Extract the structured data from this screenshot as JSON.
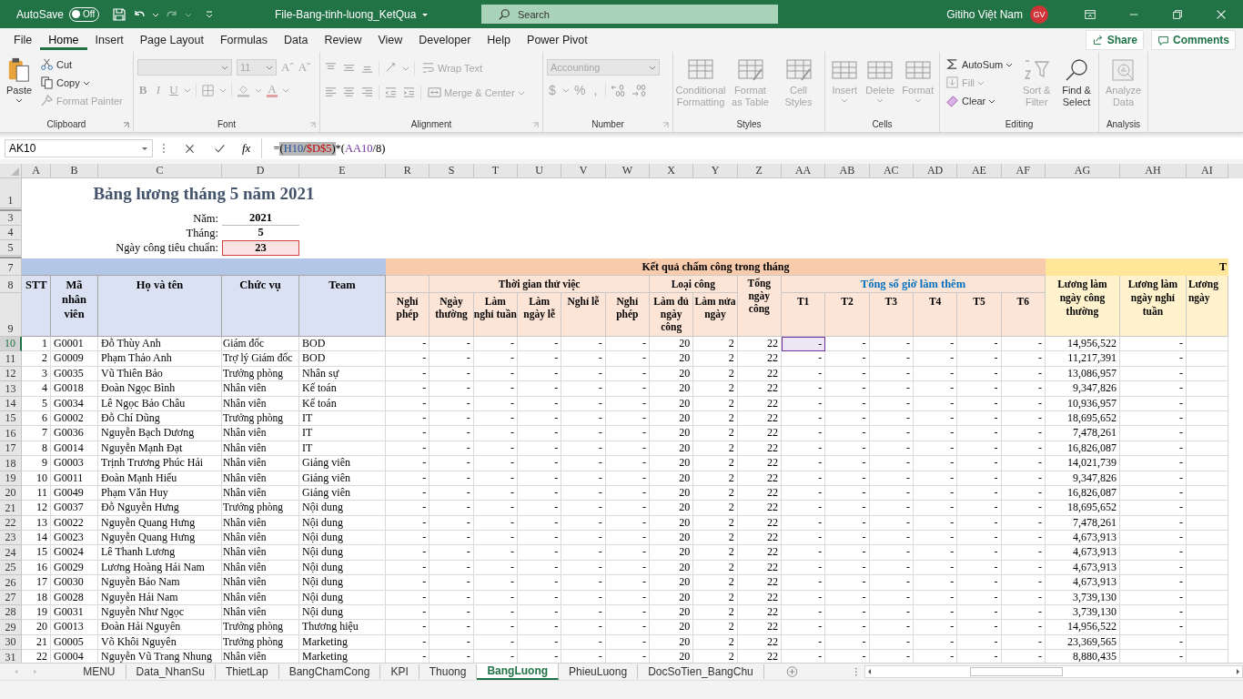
{
  "title_bar": {
    "autosave_label": "AutoSave",
    "autosave": {
      "label": "Off",
      "on": false
    },
    "redo_disabled": true,
    "file_name": "File-Bang-tinh-luong_KetQua",
    "search_placeholder": "Search",
    "user_name": "Gitiho Việt Nam",
    "avatar_initials": "GV"
  },
  "menu_tabs": [
    {
      "label": "File",
      "selected": false
    },
    {
      "label": "Home",
      "selected": true
    },
    {
      "label": "Insert",
      "selected": false
    },
    {
      "label": "Page Layout",
      "selected": false
    },
    {
      "label": "Formulas",
      "selected": false
    },
    {
      "label": "Data",
      "selected": false
    },
    {
      "label": "Review",
      "selected": false
    },
    {
      "label": "View",
      "selected": false
    },
    {
      "label": "Developer",
      "selected": false
    },
    {
      "label": "Help",
      "selected": false
    },
    {
      "label": "Power Pivot",
      "selected": false
    }
  ],
  "share": "Share",
  "comments": "Comments",
  "ribbon": {
    "clipboard": {
      "label": "Clipboard",
      "paste": {
        "label": "Paste",
        "disabled": false
      },
      "cut": {
        "label": "Cut",
        "disabled": false
      },
      "copy": {
        "label": "Copy",
        "disabled": false
      },
      "format_painter": {
        "label": "Format Painter",
        "disabled": true
      }
    },
    "font": {
      "label": "Font",
      "disabled": true,
      "size": "11",
      "grow": "Aˆ",
      "shrink": "Aˇ",
      "bold": "B",
      "italic": "I",
      "underline": "U",
      "font_color": "A"
    },
    "alignment": {
      "label": "Alignment",
      "disabled": true,
      "wrap_text": "Wrap Text",
      "merge_center": "Merge & Center"
    },
    "number": {
      "label": "Number",
      "disabled": true,
      "format": "Accounting",
      "currency": "$",
      "percent": "%",
      "comma": ","
    },
    "styles": {
      "label": "Styles",
      "disabled": true,
      "items": [
        "Conditional Formatting",
        "Format as Table",
        "Cell Styles"
      ]
    },
    "cells": {
      "label": "Cells",
      "disabled": true,
      "items": [
        "Insert",
        "Delete",
        "Format"
      ]
    },
    "editing": {
      "label": "Editing",
      "autosum": {
        "label": "AutoSum",
        "disabled": false
      },
      "fill": {
        "label": "Fill",
        "disabled": true
      },
      "clear": {
        "label": "Clear",
        "disabled": false
      },
      "sort_filter": {
        "label": "Sort & Filter",
        "disabled": true
      },
      "find_select": {
        "label": "Find & Select",
        "disabled": false
      }
    },
    "analysis": {
      "label": "Analysis",
      "analyze_data": {
        "label": "Analyze Data",
        "disabled": true
      }
    }
  },
  "formula_bar": {
    "name_box": "AK10",
    "fx": "fx",
    "tokens": [
      {
        "text": "=",
        "selected": false
      },
      {
        "text": "(",
        "selected": true
      },
      {
        "text": "H10",
        "color": "#1f4e9c",
        "selected": true
      },
      {
        "text": "/",
        "selected": true
      },
      {
        "text": "$D$5",
        "color": "#c00000",
        "selected": true
      },
      {
        "text": ")",
        "selected": true
      },
      {
        "text": "*(",
        "selected": false
      },
      {
        "text": "AA10",
        "color": "#7030a0",
        "selected": false
      },
      {
        "text": "/8)",
        "selected": false
      }
    ]
  },
  "sheet": {
    "column_headers": [
      "A",
      "B",
      "C",
      "D",
      "E",
      "R",
      "S",
      "T",
      "U",
      "V",
      "W",
      "X",
      "Y",
      "Z",
      "AA",
      "AB",
      "AC",
      "AD",
      "AE",
      "AF",
      "AG",
      "AH",
      "AI"
    ],
    "top_row_headers": [
      "1",
      "3",
      "4",
      "5",
      "7",
      "8",
      "9"
    ],
    "title": "Bảng lương tháng 5 năm 2021",
    "params": [
      {
        "label": "Năm:",
        "value": "2021",
        "referenced": false
      },
      {
        "label": "Tháng:",
        "value": "5",
        "referenced": false
      },
      {
        "label": "Ngày công tiêu chuẩn:",
        "value": "23",
        "referenced": true
      }
    ],
    "attendance_band": "Kết quả chấm công trong tháng",
    "salary_band": "T",
    "employee_headers": [
      "STT",
      "Mã nhân viên",
      "Họ và tên",
      "Chức vụ",
      "Team"
    ],
    "leave_header": "Nghỉ phép",
    "probation": {
      "label": "Thời gian thử việc",
      "columns": [
        "Ngày thường",
        "Làm nghỉ tuần",
        "Làm ngày lễ",
        "Nghỉ lễ",
        "Nghỉ phép"
      ]
    },
    "work_type": {
      "label": "Loại công",
      "columns": [
        "Làm đủ ngày công",
        "Làm nửa ngày"
      ]
    },
    "total_days": "Tổng ngày công",
    "overtime": {
      "label": "Tổng số giờ làm thêm",
      "columns": [
        "T1",
        "T2",
        "T3",
        "T4",
        "T5",
        "T6"
      ]
    },
    "salary_headers": [
      "Lương làm ngày công thường",
      "Lương làm ngày nghỉ tuần",
      "Lương ngày"
    ],
    "rows": [
      {
        "row": "10",
        "active": true,
        "stt": "1",
        "code": "G0001",
        "name": "Đỗ Thùy Anh",
        "position": "Giám đốc",
        "team": "BOD",
        "days": [
          "-",
          "-",
          "-",
          "-",
          "-",
          "-"
        ],
        "full": "20",
        "half": "2",
        "total": "22",
        "overtime": [
          "-",
          "-",
          "-",
          "-",
          "-",
          "-"
        ],
        "referenced": true,
        "salary": [
          "14,956,522",
          "-"
        ]
      },
      {
        "row": "11",
        "active": false,
        "stt": "2",
        "code": "G0009",
        "name": "Phạm Thảo Anh",
        "position": "Trợ lý Giám đốc",
        "team": "BOD",
        "days": [
          "-",
          "-",
          "-",
          "-",
          "-",
          "-"
        ],
        "full": "20",
        "half": "2",
        "total": "22",
        "overtime": [
          "-",
          "-",
          "-",
          "-",
          "-",
          "-"
        ],
        "referenced": false,
        "salary": [
          "11,217,391",
          "-"
        ]
      },
      {
        "row": "12",
        "active": false,
        "stt": "3",
        "code": "G0035",
        "name": "Vũ Thiên Bảo",
        "position": "Trưởng phòng",
        "team": "Nhân sự",
        "days": [
          "-",
          "-",
          "-",
          "-",
          "-",
          "-"
        ],
        "full": "20",
        "half": "2",
        "total": "22",
        "overtime": [
          "-",
          "-",
          "-",
          "-",
          "-",
          "-"
        ],
        "referenced": false,
        "salary": [
          "13,086,957",
          "-"
        ]
      },
      {
        "row": "13",
        "active": false,
        "stt": "4",
        "code": "G0018",
        "name": "Đoàn Ngọc Bình",
        "position": "Nhân viên",
        "team": "Kế toán",
        "days": [
          "-",
          "-",
          "-",
          "-",
          "-",
          "-"
        ],
        "full": "20",
        "half": "2",
        "total": "22",
        "overtime": [
          "-",
          "-",
          "-",
          "-",
          "-",
          "-"
        ],
        "referenced": false,
        "salary": [
          "9,347,826",
          "-"
        ]
      },
      {
        "row": "14",
        "active": false,
        "stt": "5",
        "code": "G0034",
        "name": "Lê Ngọc Bảo Châu",
        "position": "Nhân viên",
        "team": "Kế toán",
        "days": [
          "-",
          "-",
          "-",
          "-",
          "-",
          "-"
        ],
        "full": "20",
        "half": "2",
        "total": "22",
        "overtime": [
          "-",
          "-",
          "-",
          "-",
          "-",
          "-"
        ],
        "referenced": false,
        "salary": [
          "10,936,957",
          "-"
        ]
      },
      {
        "row": "15",
        "active": false,
        "stt": "6",
        "code": "G0002",
        "name": "Đỗ Chí Dũng",
        "position": "Trưởng phòng",
        "team": "IT",
        "days": [
          "-",
          "-",
          "-",
          "-",
          "-",
          "-"
        ],
        "full": "20",
        "half": "2",
        "total": "22",
        "overtime": [
          "-",
          "-",
          "-",
          "-",
          "-",
          "-"
        ],
        "referenced": false,
        "salary": [
          "18,695,652",
          "-"
        ]
      },
      {
        "row": "16",
        "active": false,
        "stt": "7",
        "code": "G0036",
        "name": "Nguyễn Bạch Dương",
        "position": "Nhân viên",
        "team": "IT",
        "days": [
          "-",
          "-",
          "-",
          "-",
          "-",
          "-"
        ],
        "full": "20",
        "half": "2",
        "total": "22",
        "overtime": [
          "-",
          "-",
          "-",
          "-",
          "-",
          "-"
        ],
        "referenced": false,
        "salary": [
          "7,478,261",
          "-"
        ]
      },
      {
        "row": "17",
        "active": false,
        "stt": "8",
        "code": "G0014",
        "name": "Nguyễn Mạnh Đạt",
        "position": "Nhân viên",
        "team": "IT",
        "days": [
          "-",
          "-",
          "-",
          "-",
          "-",
          "-"
        ],
        "full": "20",
        "half": "2",
        "total": "22",
        "overtime": [
          "-",
          "-",
          "-",
          "-",
          "-",
          "-"
        ],
        "referenced": false,
        "salary": [
          "16,826,087",
          "-"
        ]
      },
      {
        "row": "18",
        "active": false,
        "stt": "9",
        "code": "G0003",
        "name": "Trịnh Trương Phúc Hải",
        "position": "Nhân viên",
        "team": "Giảng viên",
        "days": [
          "-",
          "-",
          "-",
          "-",
          "-",
          "-"
        ],
        "full": "20",
        "half": "2",
        "total": "22",
        "overtime": [
          "-",
          "-",
          "-",
          "-",
          "-",
          "-"
        ],
        "referenced": false,
        "salary": [
          "14,021,739",
          "-"
        ]
      },
      {
        "row": "19",
        "active": false,
        "stt": "10",
        "code": "G0011",
        "name": "Đoàn Mạnh Hiếu",
        "position": "Nhân viên",
        "team": "Giảng viên",
        "days": [
          "-",
          "-",
          "-",
          "-",
          "-",
          "-"
        ],
        "full": "20",
        "half": "2",
        "total": "22",
        "overtime": [
          "-",
          "-",
          "-",
          "-",
          "-",
          "-"
        ],
        "referenced": false,
        "salary": [
          "9,347,826",
          "-"
        ]
      },
      {
        "row": "20",
        "active": false,
        "stt": "11",
        "code": "G0049",
        "name": "Phạm Văn Huy",
        "position": "Nhân viên",
        "team": "Giảng viên",
        "days": [
          "-",
          "-",
          "-",
          "-",
          "-",
          "-"
        ],
        "full": "20",
        "half": "2",
        "total": "22",
        "overtime": [
          "-",
          "-",
          "-",
          "-",
          "-",
          "-"
        ],
        "referenced": false,
        "salary": [
          "16,826,087",
          "-"
        ]
      },
      {
        "row": "21",
        "active": false,
        "stt": "12",
        "code": "G0037",
        "name": "Đỗ Nguyễn Hưng",
        "position": "Trưởng phòng",
        "team": "Nội dung",
        "days": [
          "-",
          "-",
          "-",
          "-",
          "-",
          "-"
        ],
        "full": "20",
        "half": "2",
        "total": "22",
        "overtime": [
          "-",
          "-",
          "-",
          "-",
          "-",
          "-"
        ],
        "referenced": false,
        "salary": [
          "18,695,652",
          "-"
        ]
      },
      {
        "row": "22",
        "active": false,
        "stt": "13",
        "code": "G0022",
        "name": "Nguyễn Quang Hưng",
        "position": "Nhân viên",
        "team": "Nội dung",
        "days": [
          "-",
          "-",
          "-",
          "-",
          "-",
          "-"
        ],
        "full": "20",
        "half": "2",
        "total": "22",
        "overtime": [
          "-",
          "-",
          "-",
          "-",
          "-",
          "-"
        ],
        "referenced": false,
        "salary": [
          "7,478,261",
          "-"
        ]
      },
      {
        "row": "23",
        "active": false,
        "stt": "14",
        "code": "G0023",
        "name": "Nguyễn Quang Hưng",
        "position": "Nhân viên",
        "team": "Nội dung",
        "days": [
          "-",
          "-",
          "-",
          "-",
          "-",
          "-"
        ],
        "full": "20",
        "half": "2",
        "total": "22",
        "overtime": [
          "-",
          "-",
          "-",
          "-",
          "-",
          "-"
        ],
        "referenced": false,
        "salary": [
          "4,673,913",
          "-"
        ]
      },
      {
        "row": "24",
        "active": false,
        "stt": "15",
        "code": "G0024",
        "name": "Lê Thanh Lương",
        "position": "Nhân viên",
        "team": "Nội dung",
        "days": [
          "-",
          "-",
          "-",
          "-",
          "-",
          "-"
        ],
        "full": "20",
        "half": "2",
        "total": "22",
        "overtime": [
          "-",
          "-",
          "-",
          "-",
          "-",
          "-"
        ],
        "referenced": false,
        "salary": [
          "4,673,913",
          "-"
        ]
      },
      {
        "row": "25",
        "active": false,
        "stt": "16",
        "code": "G0029",
        "name": "Lương Hoàng Hải Nam",
        "position": "Nhân viên",
        "team": "Nội dung",
        "days": [
          "-",
          "-",
          "-",
          "-",
          "-",
          "-"
        ],
        "full": "20",
        "half": "2",
        "total": "22",
        "overtime": [
          "-",
          "-",
          "-",
          "-",
          "-",
          "-"
        ],
        "referenced": false,
        "salary": [
          "4,673,913",
          "-"
        ]
      },
      {
        "row": "26",
        "active": false,
        "stt": "17",
        "code": "G0030",
        "name": "Nguyễn Bảo Nam",
        "position": "Nhân viên",
        "team": "Nội dung",
        "days": [
          "-",
          "-",
          "-",
          "-",
          "-",
          "-"
        ],
        "full": "20",
        "half": "2",
        "total": "22",
        "overtime": [
          "-",
          "-",
          "-",
          "-",
          "-",
          "-"
        ],
        "referenced": false,
        "salary": [
          "4,673,913",
          "-"
        ]
      },
      {
        "row": "27",
        "active": false,
        "stt": "18",
        "code": "G0028",
        "name": "Nguyễn Hải Nam",
        "position": "Nhân viên",
        "team": "Nội dung",
        "days": [
          "-",
          "-",
          "-",
          "-",
          "-",
          "-"
        ],
        "full": "20",
        "half": "2",
        "total": "22",
        "overtime": [
          "-",
          "-",
          "-",
          "-",
          "-",
          "-"
        ],
        "referenced": false,
        "salary": [
          "3,739,130",
          "-"
        ]
      },
      {
        "row": "28",
        "active": false,
        "stt": "19",
        "code": "G0031",
        "name": "Nguyễn Như Ngọc",
        "position": "Nhân viên",
        "team": "Nội dung",
        "days": [
          "-",
          "-",
          "-",
          "-",
          "-",
          "-"
        ],
        "full": "20",
        "half": "2",
        "total": "22",
        "overtime": [
          "-",
          "-",
          "-",
          "-",
          "-",
          "-"
        ],
        "referenced": false,
        "salary": [
          "3,739,130",
          "-"
        ]
      },
      {
        "row": "29",
        "active": false,
        "stt": "20",
        "code": "G0013",
        "name": "Đoàn Hải Nguyên",
        "position": "Trưởng phòng",
        "team": "Thương hiệu",
        "days": [
          "-",
          "-",
          "-",
          "-",
          "-",
          "-"
        ],
        "full": "20",
        "half": "2",
        "total": "22",
        "overtime": [
          "-",
          "-",
          "-",
          "-",
          "-",
          "-"
        ],
        "referenced": false,
        "salary": [
          "14,956,522",
          "-"
        ]
      },
      {
        "row": "30",
        "active": false,
        "stt": "21",
        "code": "G0005",
        "name": "Võ Khôi Nguyên",
        "position": "Trưởng phòng",
        "team": "Marketing",
        "days": [
          "-",
          "-",
          "-",
          "-",
          "-",
          "-"
        ],
        "full": "20",
        "half": "2",
        "total": "22",
        "overtime": [
          "-",
          "-",
          "-",
          "-",
          "-",
          "-"
        ],
        "referenced": false,
        "salary": [
          "23,369,565",
          "-"
        ]
      },
      {
        "row": "31",
        "active": false,
        "stt": "22",
        "code": "G0004",
        "name": "Nguyễn Vũ Trang Nhung",
        "position": "Nhân viên",
        "team": "Marketing",
        "days": [
          "-",
          "-",
          "-",
          "-",
          "-",
          "-"
        ],
        "full": "20",
        "half": "2",
        "total": "22",
        "overtime": [
          "-",
          "-",
          "-",
          "-",
          "-",
          "-"
        ],
        "referenced": false,
        "salary": [
          "8,880,435",
          "-"
        ]
      }
    ]
  },
  "sheet_tabs": [
    {
      "label": "MENU",
      "selected": false
    },
    {
      "label": "Data_NhanSu",
      "selected": false
    },
    {
      "label": "ThietLap",
      "selected": false
    },
    {
      "label": "BangChamCong",
      "selected": false
    },
    {
      "label": "KPI",
      "selected": false
    },
    {
      "label": "Thuong",
      "selected": false
    },
    {
      "label": "BangLuong",
      "selected": true
    },
    {
      "label": "PhieuLuong",
      "selected": false
    },
    {
      "label": "DocSoTien_BangChu",
      "selected": false
    }
  ]
}
